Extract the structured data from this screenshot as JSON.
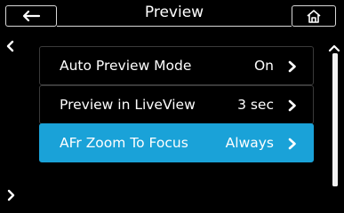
{
  "header": {
    "title": "Preview",
    "back_icon": "back-arrow-icon",
    "home_icon": "home-icon"
  },
  "nav": {
    "left_icon": "chevron-left-icon",
    "right_icon": "chevron-right-icon"
  },
  "menu": {
    "items": [
      {
        "label": "Auto Preview Mode",
        "value": "On",
        "selected": false
      },
      {
        "label": "Preview in LiveView",
        "value": "3 sec",
        "selected": false
      },
      {
        "label": "AFr Zoom To Focus",
        "value": "Always",
        "selected": true
      }
    ]
  },
  "colors": {
    "selected": "#1aa2d8",
    "border": "#3a3a3a",
    "background": "#000000"
  }
}
